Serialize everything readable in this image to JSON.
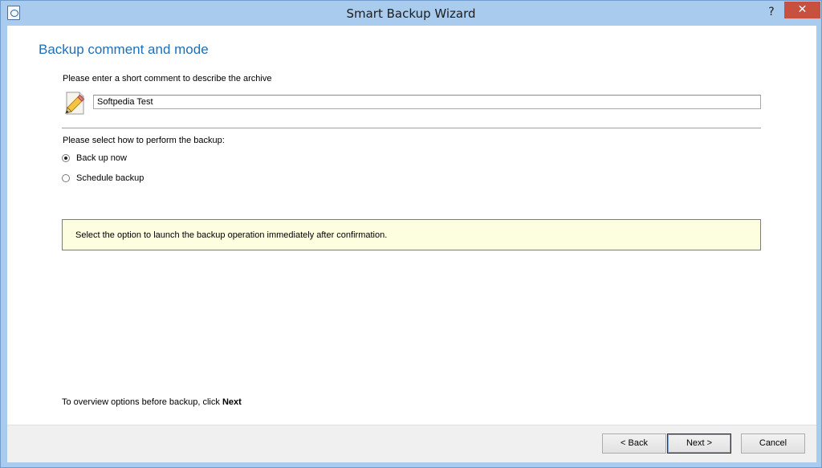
{
  "window": {
    "title": "Smart Backup Wizard",
    "help_glyph": "?",
    "close_glyph": "✕"
  },
  "page": {
    "heading": "Backup comment and mode",
    "comment_prompt": "Please enter a short comment to describe the archive",
    "comment_value": "Softpedia Test",
    "mode_prompt": "Please select how to perform the backup:",
    "options": [
      {
        "label": "Back up now",
        "checked": true
      },
      {
        "label": "Schedule backup",
        "checked": false
      }
    ],
    "info_text": "Select the option to launch the backup operation immediately after confirmation.",
    "hint_text": "To overview options before backup, click ",
    "hint_emphasis": "Next"
  },
  "footer": {
    "back_label": "< Back",
    "next_label": "Next >",
    "cancel_label": "Cancel"
  },
  "icons": {
    "app": "backup-app-icon",
    "comment": "pencil-paper-icon"
  },
  "colors": {
    "heading": "#1e6fb8",
    "info_background": "#fdfde0",
    "close_button": "#c7503f",
    "frame": "#a9cbee"
  }
}
